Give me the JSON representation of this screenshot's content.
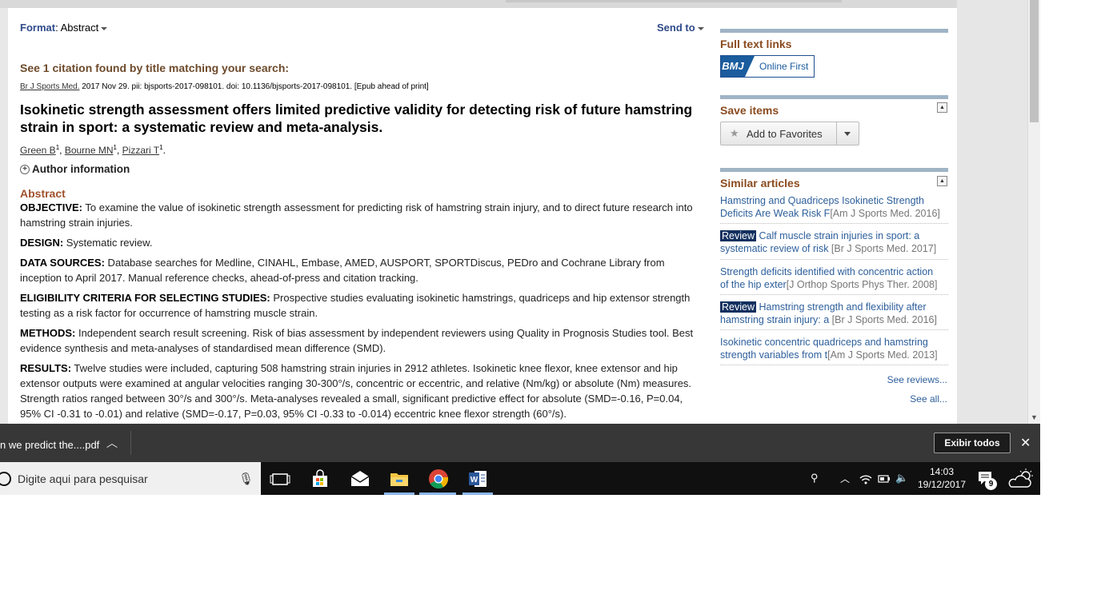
{
  "header": {
    "format_label": "Format",
    "format_value": "Abstract",
    "send_to": "Send to"
  },
  "citation": {
    "found_text": "See 1 citation found by title matching your search:",
    "journal": "Br J Sports Med.",
    "source_rest": " 2017 Nov 29. pii: bjsports-2017-098101. doi: 10.1136/bjsports-2017-098101. [Epub ahead of print]",
    "title": "Isokinetic strength assessment offers limited predictive validity for detecting risk of future hamstring strain in sport: a systematic review and meta-analysis.",
    "authors": [
      {
        "name": "Green B",
        "sup": "1"
      },
      {
        "name": "Bourne MN",
        "sup": "1"
      },
      {
        "name": "Pizzari T",
        "sup": "1"
      }
    ],
    "author_info": "Author information"
  },
  "abstract": {
    "heading": "Abstract",
    "sections": [
      {
        "label": "OBJECTIVE:",
        "text": " To examine the value of isokinetic strength assessment for predicting risk of hamstring strain injury, and to direct future research into hamstring strain injuries."
      },
      {
        "label": "DESIGN:",
        "text": " Systematic review."
      },
      {
        "label": "DATA SOURCES:",
        "text": " Database searches for Medline, CINAHL, Embase, AMED, AUSPORT, SPORTDiscus, PEDro and Cochrane Library from inception to April 2017. Manual reference checks, ahead-of-press and citation tracking."
      },
      {
        "label": "ELIGIBILITY CRITERIA FOR SELECTING STUDIES:",
        "text": " Prospective studies evaluating isokinetic hamstrings, quadriceps and hip extensor strength testing as a risk factor for occurrence of hamstring muscle strain."
      },
      {
        "label": "METHODS:",
        "text": " Independent search result screening. Risk of bias assessment by independent reviewers using Quality in Prognosis Studies tool. Best evidence synthesis and meta-analyses of standardised mean difference (SMD)."
      },
      {
        "label": "RESULTS:",
        "text": " Twelve studies were included, capturing 508 hamstring strain injuries in 2912 athletes. Isokinetic knee flexor, knee extensor and hip extensor outputs were examined at angular velocities ranging 30-300°/s, concentric or eccentric, and relative (Nm/kg) or absolute (Nm) measures. Strength ratios ranged between 30°/s and 300°/s. Meta-analyses revealed a small, significant predictive effect for absolute (SMD=-0.16, P=0.04, 95% CI -0.31 to -0.01) and relative (SMD=-0.17, P=0.03, 95% CI -0.33 to -0.014) eccentric knee flexor strength (60°/s)."
      }
    ]
  },
  "sidebar": {
    "full_text_heading": "Full text links",
    "bmj_logo": "BMJ",
    "bmj_text": "Online First",
    "save_heading": "Save items",
    "add_favorites": "Add to Favorites",
    "similar_heading": "Similar articles",
    "review_badge": "Review",
    "similar": [
      {
        "review": false,
        "line1": "Hamstring and Quadriceps Isokinetic Strength",
        "line2": "Deficits Are Weak Risk F",
        "meta": "[Am J Sports Med. 2016]"
      },
      {
        "review": true,
        "line1": " Calf muscle strain injuries in sport: a",
        "line2": "systematic review of risk",
        "meta": " [Br J Sports Med. 2017]"
      },
      {
        "review": false,
        "line1": "Strength deficits identified with concentric action",
        "line2": "of the hip exter",
        "meta": "[J Orthop Sports Phys Ther. 2008]"
      },
      {
        "review": true,
        "line1": " Hamstring strength and flexibility after",
        "line2": "hamstring strain injury: a",
        "meta": " [Br J Sports Med. 2016]"
      },
      {
        "review": false,
        "line1": "Isokinetic concentric quadriceps and hamstring",
        "line2": "strength variables from t",
        "meta": "[Am J Sports Med. 2013]"
      }
    ],
    "see_reviews": "See reviews...",
    "see_all": "See all..."
  },
  "download_bar": {
    "file": "n we predict the....pdf",
    "show_all": "Exibir todos"
  },
  "taskbar": {
    "search_placeholder": "Digite aqui para pesquisar",
    "time": "14:03",
    "date": "19/12/2017",
    "notifications": "9"
  }
}
